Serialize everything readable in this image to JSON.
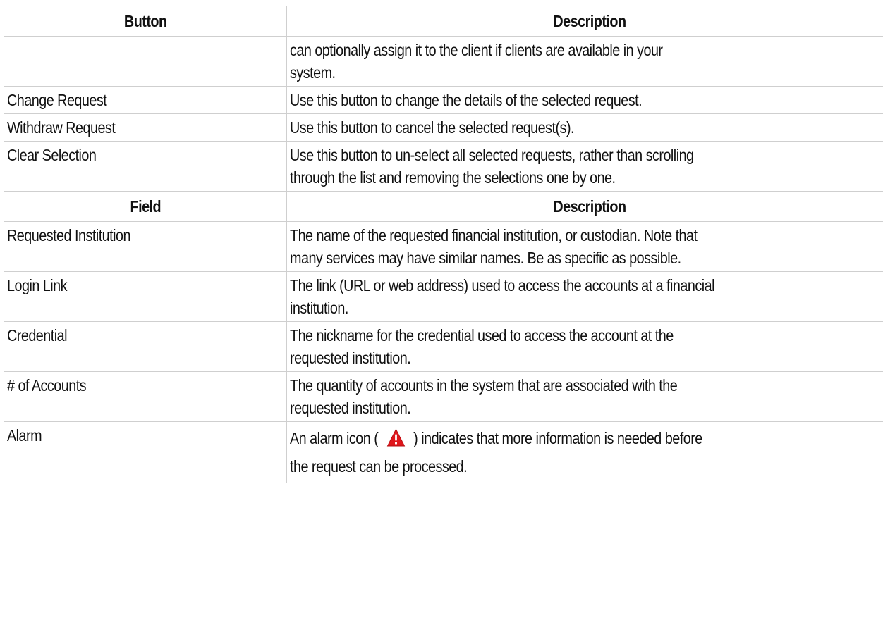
{
  "buttons_table": {
    "header": {
      "col1": "Button",
      "col2": "Description"
    },
    "rows": [
      {
        "name": "",
        "desc_lines": [
          "can optionally assign it to the client if clients are available in your",
          "system."
        ]
      },
      {
        "name": "Change Request",
        "desc_lines": [
          "Use this button to change the details of the selected request."
        ]
      },
      {
        "name": "Withdraw Request",
        "desc_lines": [
          "Use this button to cancel the selected request(s)."
        ]
      },
      {
        "name": "Clear Selection",
        "desc_lines": [
          "Use this button to un-select all selected requests, rather than scrolling",
          "through the list and removing the selections one by one."
        ]
      }
    ]
  },
  "fields_table": {
    "header": {
      "col1": "Field",
      "col2": "Description"
    },
    "rows": [
      {
        "name": "Requested Institution",
        "desc_lines": [
          "The name of the requested financial institution, or custodian. Note that",
          "many services may have similar names. Be as specific as possible."
        ]
      },
      {
        "name": "Login Link",
        "desc_lines": [
          "The link (URL or web address) used to access the accounts at a financial",
          "institution."
        ]
      },
      {
        "name": "Credential",
        "desc_lines": [
          "The nickname for the credential used to access the account at the",
          "requested institution."
        ]
      },
      {
        "name": "# of Accounts",
        "desc_lines": [
          "The quantity of accounts in the system that are associated with the",
          "requested institution."
        ]
      },
      {
        "name": "Alarm",
        "desc_before_icon": "An alarm icon (",
        "desc_after_icon": ") indicates that more information is needed before",
        "desc_line2": "the request can be processed."
      }
    ]
  },
  "icons": {
    "alarm": "alarm-warning-icon"
  },
  "colors": {
    "alarm_red": "#e0161b",
    "border": "#cfcfcf"
  }
}
